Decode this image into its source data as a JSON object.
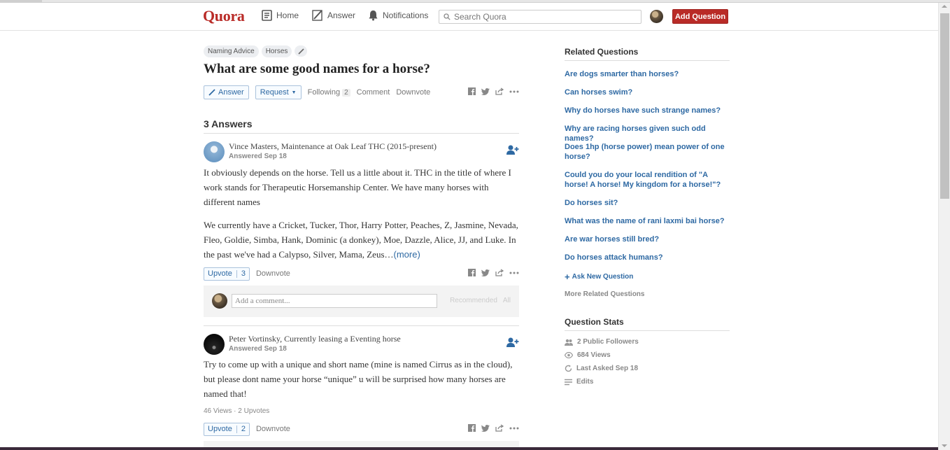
{
  "header": {
    "logo": "Quora",
    "nav": {
      "home": "Home",
      "answer": "Answer",
      "notifications": "Notifications"
    },
    "search_placeholder": "Search Quora",
    "add_question": "Add Question"
  },
  "question": {
    "topics": [
      "Naming Advice",
      "Horses"
    ],
    "title": "What are some good names for a horse?",
    "answer_label": "Answer",
    "request_label": "Request",
    "following_label": "Following",
    "following_count": "2",
    "comment_label": "Comment",
    "downvote_label": "Downvote"
  },
  "answers_count": "3 Answers",
  "answers": [
    {
      "author": "Vince Masters, Maintenance at Oak Leaf THC (2015-present)",
      "date": "Answered Sep 18",
      "paragraph1": "It obviously depends on the horse. Tell us a little about it. THC in the title of where I work stands for Therapeutic Horsemanship Center. We have many horses with different names",
      "paragraph2": "We currently have a Cricket, Tucker, Thor, Harry Potter, Peaches, Z, Jasmine, Nevada, Fleo, Goldie, Simba, Hank, Dominic (a donkey), Moe, Dazzle, Alice, JJ, and Luke. In the past we've had a Calypso, Silver, Mama, Zeus…",
      "more": "(more)",
      "upvote_label": "Upvote",
      "upvote_count": "3",
      "downvote_label": "Downvote"
    },
    {
      "author": "Peter Vortinsky, Currently leasing a Eventing horse",
      "date": "Answered Sep 18",
      "paragraph1": "Try to come up with a unique and short name (mine is named Cirrus as in the cloud), but please dont name your horse “unique” u will be surprised how many horses are named that!",
      "stats": "46 Views · 2 Upvotes",
      "upvote_label": "Upvote",
      "upvote_count": "2",
      "downvote_label": "Downvote"
    }
  ],
  "comment": {
    "placeholder": "Add a comment...",
    "recommended": "Recommended",
    "all": "All"
  },
  "sidebar": {
    "related_heading": "Related Questions",
    "related": [
      "Are dogs smarter than horses?",
      "Can horses swim?",
      "Why do horses have such strange names?",
      "Why are racing horses given such odd names?",
      "Does 1hp (horse power) mean power of one horse?",
      "Could you do your local rendition of \"A horse! A horse! My kingdom for a horse!\"?",
      "Do horses sit?",
      "What was the name of rani laxmi bai horse?",
      "Are war horses still bred?",
      "Do horses attack humans?"
    ],
    "ask_new": "Ask New Question",
    "more_related": "More Related Questions",
    "stats_heading": "Question Stats",
    "stats": {
      "followers": "2 Public Followers",
      "views": "684 Views",
      "last_asked": "Last Asked Sep 18",
      "edits": "Edits"
    }
  },
  "colors": {
    "brand": "#b92b27",
    "link": "#2e69a3"
  }
}
